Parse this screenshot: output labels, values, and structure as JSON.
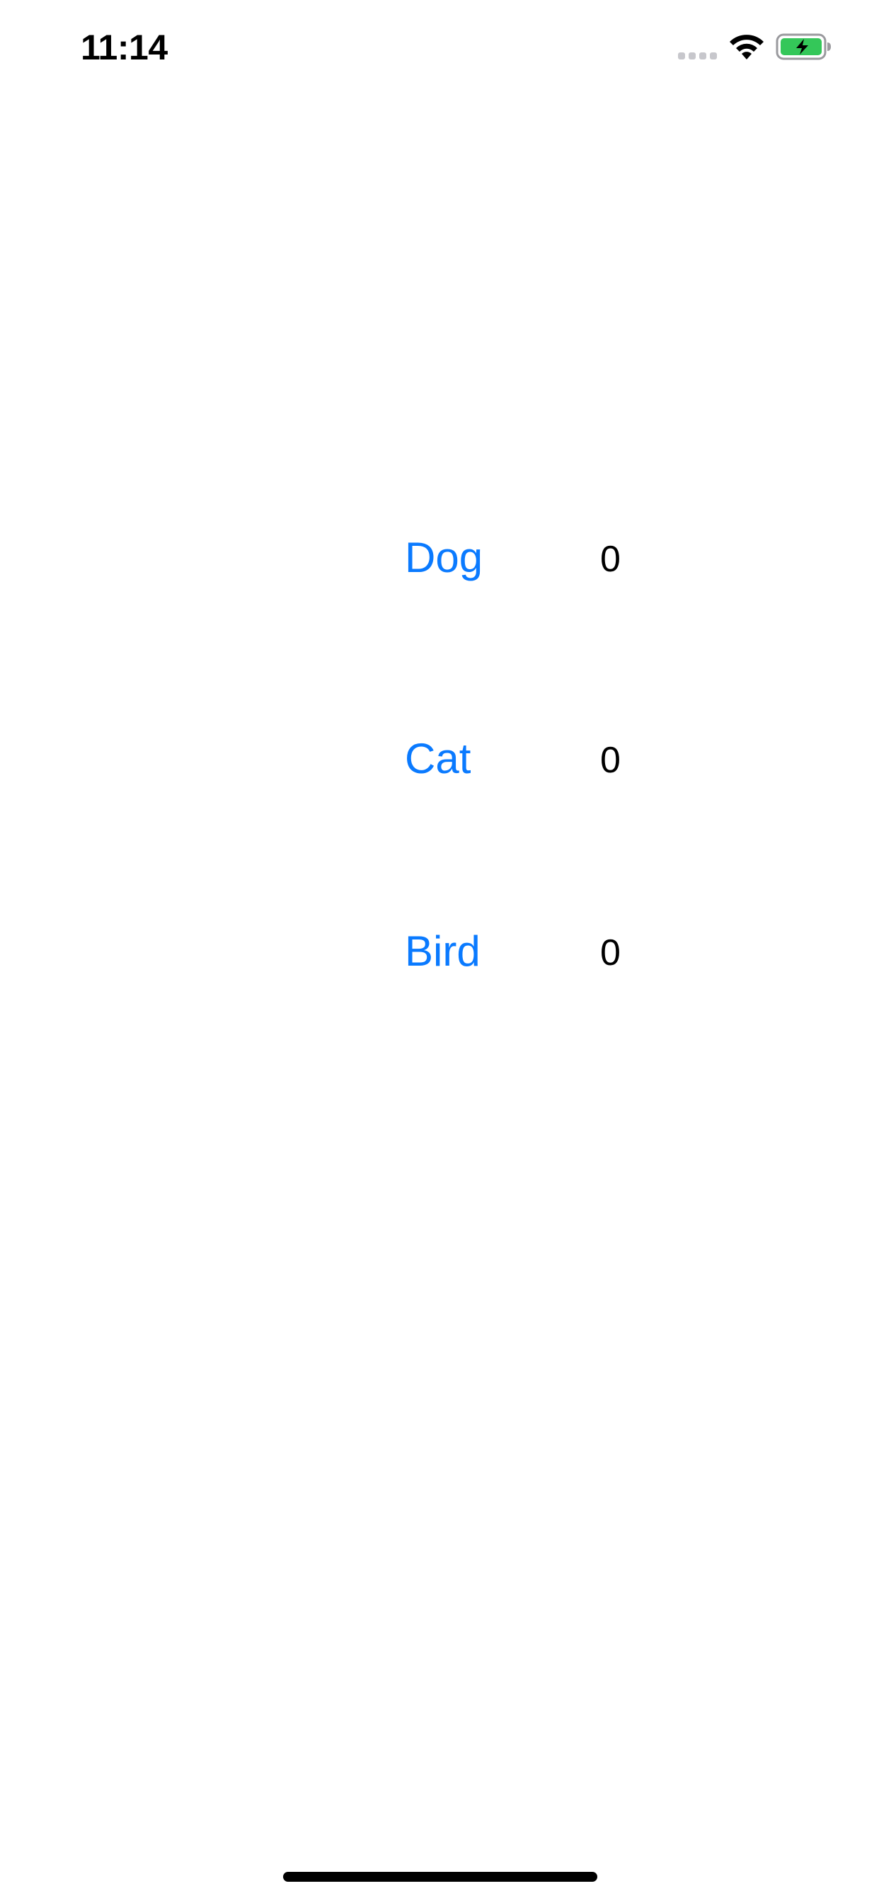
{
  "status_bar": {
    "time": "11:14",
    "icons": [
      "cellular-signal-icon",
      "wifi-icon",
      "battery-charging-icon"
    ],
    "battery_color": "#34c759"
  },
  "animals": [
    {
      "label": "Dog",
      "count": "0"
    },
    {
      "label": "Cat",
      "count": "0"
    },
    {
      "label": "Bird",
      "count": "0"
    }
  ],
  "colors": {
    "accent": "#0a7aff",
    "text": "#000000",
    "background": "#ffffff"
  }
}
